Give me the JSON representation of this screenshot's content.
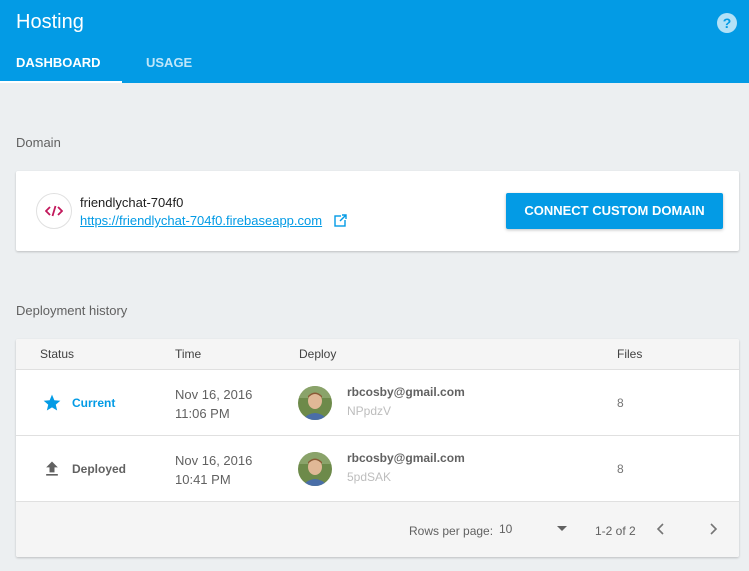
{
  "header": {
    "title": "Hosting",
    "help_icon": "help-icon",
    "tabs": [
      {
        "label": "DASHBOARD",
        "active": true
      },
      {
        "label": "USAGE",
        "active": false
      }
    ]
  },
  "domain_section": {
    "label": "Domain",
    "site_name": "friendlychat-704f0",
    "site_url": "https://friendlychat-704f0.firebaseapp.com",
    "connect_button": "CONNECT CUSTOM DOMAIN"
  },
  "deploy_section": {
    "label": "Deployment history",
    "columns": {
      "status": "Status",
      "time": "Time",
      "deploy": "Deploy",
      "files": "Files"
    },
    "rows": [
      {
        "status": "Current",
        "status_icon": "star-icon",
        "status_color": "#039be5",
        "date": "Nov 16, 2016",
        "time": "11:06 PM",
        "email": "rbcosby@gmail.com",
        "hash": "NPpdzV",
        "files": "8"
      },
      {
        "status": "Deployed",
        "status_icon": "upload-icon",
        "status_color": "#616161",
        "date": "Nov 16, 2016",
        "time": "10:41 PM",
        "email": "rbcosby@gmail.com",
        "hash": "5pdSAK",
        "files": "8"
      }
    ],
    "footer": {
      "rows_per_page_label": "Rows per page:",
      "rows_per_page_value": "10",
      "range": "1-2 of 2"
    }
  },
  "colors": {
    "accent": "#039be5",
    "background": "#eceff1",
    "code_icon": "#c2185b"
  }
}
